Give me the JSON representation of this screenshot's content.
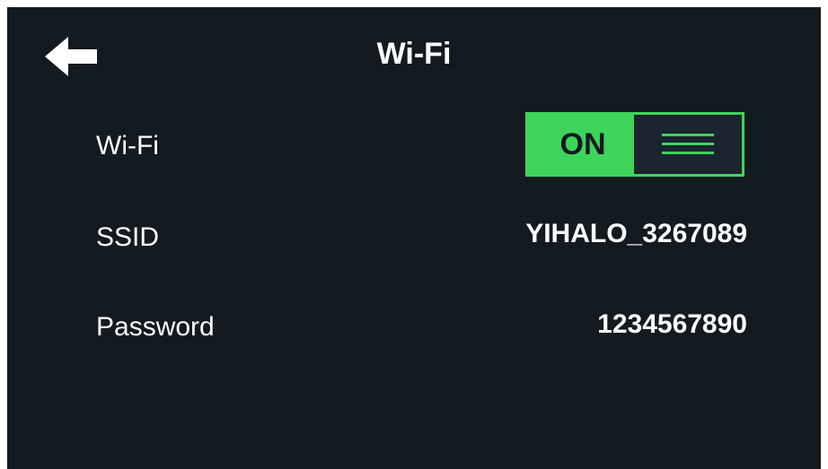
{
  "header": {
    "back_icon": "arrow-left-icon",
    "title": "Wi-Fi"
  },
  "settings": {
    "wifi": {
      "label": "Wi-Fi",
      "state": "ON",
      "on": true
    },
    "ssid": {
      "label": "SSID",
      "value": "YIHALO_3267089"
    },
    "password": {
      "label": "Password",
      "value": "1234567890"
    }
  },
  "colors": {
    "background": "#131a20",
    "accent": "#3ed45b",
    "text": "#ffffff"
  }
}
